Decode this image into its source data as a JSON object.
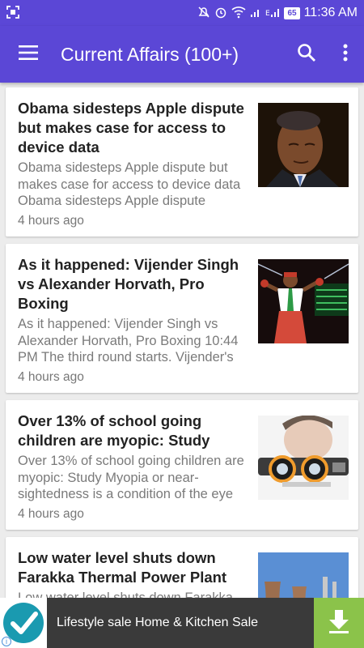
{
  "status_bar": {
    "battery": "65",
    "time": "11:36 AM"
  },
  "app_bar": {
    "title": "Current Affairs (100+)"
  },
  "articles": [
    {
      "title": "Obama sidesteps Apple dispute but makes case for access to device data",
      "summary": "Obama sidesteps Apple dispute but makes case for access to device data Obama sidesteps Apple dispute",
      "time": "4 hours ago"
    },
    {
      "title": "As it happened: Vijender Singh vs Alexander Horvath, Pro Boxing",
      "summary": "As it happened: Vijender Singh vs Alexander Horvath, Pro Boxing 10:44 PM  The third round starts. Vijender's",
      "time": "4 hours ago"
    },
    {
      "title": "Over 13% of school going children are myopic: Study",
      "summary": "Over 13% of school going children are myopic: Study Myopia or near-sightedness is a condition of the eye",
      "time": "4 hours ago"
    },
    {
      "title": "Low water level shuts down Farakka Thermal Power Plant",
      "summary": "Low water level shuts down Farakka",
      "time": ""
    }
  ],
  "ad": {
    "text": "Lifestyle sale Home & Kitchen Sale",
    "info": "i"
  },
  "colors": {
    "primary": "#5b47d6",
    "download_button": "#8bc34a"
  }
}
